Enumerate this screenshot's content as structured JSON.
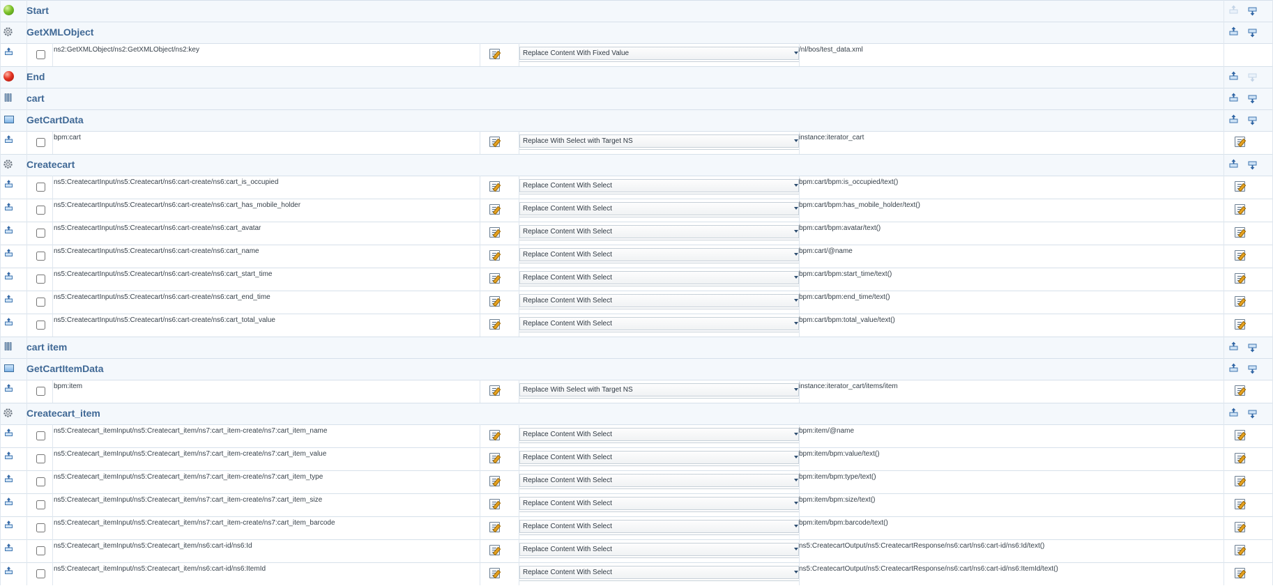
{
  "rows": [
    {
      "kind": "header",
      "icon": "start-icon",
      "title": "Start",
      "up": false,
      "down": true
    },
    {
      "kind": "header",
      "icon": "gear-icon",
      "title": "GetXMLObject",
      "up": true,
      "down": true
    },
    {
      "kind": "param",
      "xpath": "ns2:GetXMLObject/ns2:GetXMLObject/ns2:key",
      "mode": "Replace Content With Fixed Value",
      "value": "/nl/bos/test_data.xml",
      "edit": false
    },
    {
      "kind": "header",
      "icon": "end-icon",
      "title": "End",
      "up": true,
      "down": false
    },
    {
      "kind": "header",
      "icon": "loop-icon",
      "title": "cart",
      "up": true,
      "down": true
    },
    {
      "kind": "header",
      "icon": "screen-icon",
      "title": "GetCartData",
      "up": true,
      "down": true
    },
    {
      "kind": "param",
      "xpath": "bpm:cart",
      "mode": "Replace With Select with Target NS",
      "value": "instance:iterator_cart",
      "edit": true
    },
    {
      "kind": "header",
      "icon": "gear-icon",
      "title": "Createcart",
      "up": true,
      "down": true
    },
    {
      "kind": "param",
      "xpath": "ns5:CreatecartInput/ns5:Createcart/ns6:cart-create/ns6:cart_is_occupied",
      "mode": "Replace Content With Select",
      "value": "bpm:cart/bpm:is_occupied/text()",
      "edit": true
    },
    {
      "kind": "param",
      "xpath": "ns5:CreatecartInput/ns5:Createcart/ns6:cart-create/ns6:cart_has_mobile_holder",
      "mode": "Replace Content With Select",
      "value": "bpm:cart/bpm:has_mobile_holder/text()",
      "edit": true
    },
    {
      "kind": "param",
      "xpath": "ns5:CreatecartInput/ns5:Createcart/ns6:cart-create/ns6:cart_avatar",
      "mode": "Replace Content With Select",
      "value": "bpm:cart/bpm:avatar/text()",
      "edit": true
    },
    {
      "kind": "param",
      "xpath": "ns5:CreatecartInput/ns5:Createcart/ns6:cart-create/ns6:cart_name",
      "mode": "Replace Content With Select",
      "value": "bpm:cart/@name",
      "edit": true
    },
    {
      "kind": "param",
      "xpath": "ns5:CreatecartInput/ns5:Createcart/ns6:cart-create/ns6:cart_start_time",
      "mode": "Replace Content With Select",
      "value": "bpm:cart/bpm:start_time/text()",
      "edit": true
    },
    {
      "kind": "param",
      "xpath": "ns5:CreatecartInput/ns5:Createcart/ns6:cart-create/ns6:cart_end_time",
      "mode": "Replace Content With Select",
      "value": "bpm:cart/bpm:end_time/text()",
      "edit": true
    },
    {
      "kind": "param",
      "xpath": "ns5:CreatecartInput/ns5:Createcart/ns6:cart-create/ns6:cart_total_value",
      "mode": "Replace Content With Select",
      "value": "bpm:cart/bpm:total_value/text()",
      "edit": true
    },
    {
      "kind": "header",
      "icon": "loop-icon",
      "title": "cart item",
      "up": true,
      "down": true
    },
    {
      "kind": "header",
      "icon": "screen-icon",
      "title": "GetCartItemData",
      "up": true,
      "down": true
    },
    {
      "kind": "param",
      "xpath": "bpm:item",
      "mode": "Replace With Select with Target NS",
      "value": "instance:iterator_cart/items/item",
      "edit": true
    },
    {
      "kind": "header",
      "icon": "gear-icon",
      "title": "Createcart_item",
      "up": true,
      "down": true
    },
    {
      "kind": "param",
      "xpath": "ns5:Createcart_itemInput/ns5:Createcart_item/ns7:cart_item-create/ns7:cart_item_name",
      "mode": "Replace Content With Select",
      "value": "bpm:item/@name",
      "edit": true
    },
    {
      "kind": "param",
      "xpath": "ns5:Createcart_itemInput/ns5:Createcart_item/ns7:cart_item-create/ns7:cart_item_value",
      "mode": "Replace Content With Select",
      "value": "bpm:item/bpm:value/text()",
      "edit": true
    },
    {
      "kind": "param",
      "xpath": "ns5:Createcart_itemInput/ns5:Createcart_item/ns7:cart_item-create/ns7:cart_item_type",
      "mode": "Replace Content With Select",
      "value": "bpm:item/bpm:type/text()",
      "edit": true
    },
    {
      "kind": "param",
      "xpath": "ns5:Createcart_itemInput/ns5:Createcart_item/ns7:cart_item-create/ns7:cart_item_size",
      "mode": "Replace Content With Select",
      "value": "bpm:item/bpm:size/text()",
      "edit": true
    },
    {
      "kind": "param",
      "xpath": "ns5:Createcart_itemInput/ns5:Createcart_item/ns7:cart_item-create/ns7:cart_item_barcode",
      "mode": "Replace Content With Select",
      "value": "bpm:item/bpm:barcode/text()",
      "edit": true
    },
    {
      "kind": "param",
      "xpath": "ns5:Createcart_itemInput/ns5:Createcart_item/ns6:cart-id/ns6:Id",
      "mode": "Replace Content With Select",
      "value": "ns5:CreatecartOutput/ns5:CreatecartResponse/ns6:cart/ns6:cart-id/ns6:Id/text()",
      "edit": true
    },
    {
      "kind": "param",
      "xpath": "ns5:Createcart_itemInput/ns5:Createcart_item/ns6:cart-id/ns6:ItemId",
      "mode": "Replace Content With Select",
      "value": "ns5:CreatecartOutput/ns5:CreatecartResponse/ns6:cart/ns6:cart-id/ns6:ItemId/text()",
      "edit": true
    }
  ]
}
